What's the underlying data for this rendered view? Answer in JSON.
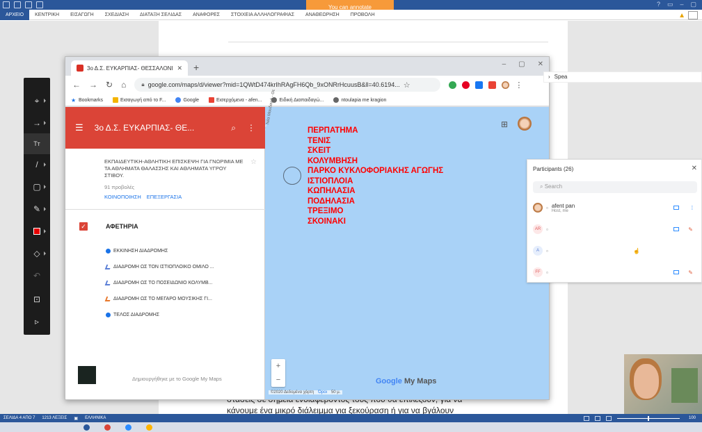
{
  "word": {
    "ribbon_tabs": [
      "ΑΡΧΕΙΟ",
      "ΚΕΝΤΡΙΚΗ",
      "ΕΙΣΑΓΩΓΗ",
      "ΣΧΕΔΙΑΣΗ",
      "ΔΙΑΤΑΞΗ ΣΕΛΙΔΑΣ",
      "ΑΝΑΦΟΡΕΣ",
      "ΣΤΟΙΧΕΙΑ ΑΛΛΗΛΟΓΡΑΦΙΑΣ",
      "ΑΝΑΘΕΩΡΗΣΗ",
      "ΠΡΟΒΟΛΗ"
    ],
    "annotate_banner": "You can annotate",
    "doc_lines": [
      "στάσεις σε σημεία ενδιαφέροντος τους που θα επιλέξουν, για να",
      "κάνουμε ένα μικρό διάλειμμα για ξεκούραση ή για να βγάλουν"
    ],
    "status": [
      "ΣΕΛΙΔΑ 4 ΑΠΟ 7",
      "1213 ΛΕΞΕΙΣ",
      "ΕΛΛΗΝΙΚΑ"
    ],
    "zoom": "100"
  },
  "chrome": {
    "tab_title": "3ο Δ.Σ. ΕΥΚΑΡΠΙΑΣ- ΘΕΣΣΑΛΟΝΙ",
    "url": "google.com/maps/d/viewer?mid=1QWtD474krIhRAgFH6Qb_9xONRrHcuusB&ll=40.6194...",
    "bookmarks": [
      "Bookmarks",
      "Εισαγωγή από το F...",
      "Google",
      "Εισερχόμενα - afen...",
      "Ειδική Διαπαιδαγώ...",
      "ntoulapia me kragion"
    ]
  },
  "map": {
    "title": "3ο Δ.Σ. ΕΥΚΑΡΠΙΑΣ- ΘΕ...",
    "description": "ΕΚΠΑΙΔΕΥΤΙΚΗ-ΑΘΛΗΤΙΚΗ ΕΠΙΣΚΕΨΗ ΓΙΑ ΓΝΩΡΙΜΙΑ ΜΕ ΤΑ ΑΘΛΗΜΑΤΑ ΘΑΛΑΣΣΗΣ ΚΑΙ ΑΘΛΗΜΑΤΑ ΥΓΡΟΥ ΣΤΙΒΟΥ.",
    "views": "91 προβολές",
    "share": "ΚΟΙΝΟΠΟΙΗΣΗ",
    "edit": "ΕΠΕΞΕΡΓΑΣΙΑ",
    "layer": "ΑΦΕΤΗΡΙΑ",
    "items": [
      {
        "label": "ΕΚΚΙΝΗΣΗ ΔΙΑΔΡΟΜΗΣ",
        "kind": "pin",
        "color": "#1a73e8"
      },
      {
        "label": "ΔΙΑΔΡΟΜΗ ΩΣ ΤΟΝ ΙΣΤΙΟΠΛΟΙΚΟ ΟΜΙΛΟ ...",
        "kind": "route",
        "color": "#5b7fd6"
      },
      {
        "label": "ΔΙΑΔΡΟΜΗ ΩΣ ΤΟ ΠΟΣΕΙΔΩΝΙΟ ΚΟΛΥΜΒ...",
        "kind": "route",
        "color": "#5b7fd6"
      },
      {
        "label": "ΔΙΑΔΡΟΜΗ ΩΣ ΤΟ ΜΕΓΑΡΟ ΜΟΥΣΙΚΗΣ ΓΙ...",
        "kind": "route",
        "color": "#e8782b"
      },
      {
        "label": "ΤΕΛΟΣ ΔΙΑΔΡΟΜΗΣ",
        "kind": "pin",
        "color": "#1a73e8"
      }
    ],
    "made_with": "Δημιουργήθηκε με το Google My Maps",
    "road_label": "Νέα Μουδανιά - Θε",
    "annotation_lines": [
      "ΠΕΡΠΑΤΗΜΑ",
      "ΤΕΝΙΣ",
      "ΣΚΕΙΤ",
      "ΚΟΛΥΜΒΗΣΗ",
      "ΠΑΡΚΟ ΚΥΚΛΟΦΟΡΙΑΚΗΣ ΑΓΩΓΗΣ",
      "ΙΣΤΙΟΠΛΟΙΑ",
      "ΚΩΠΗΛΑΣΙΑ",
      "ΠΟΔΗΛΑΣΙΑ",
      "ΤΡΕΞΙΜΟ",
      "ΣΚΟΙΝΑΚΙ"
    ],
    "copyright": "©2020 Δεδομένα χάρτη",
    "terms": "Όροι",
    "scale": "50 μ.",
    "brand_google": "Google",
    "brand_mymaps": "My Maps",
    "annotation_color": "#ff0000",
    "header_color": "#db4437"
  },
  "side": {
    "input_text": "Spea"
  },
  "participants": {
    "title": "Participants (26)",
    "search_placeholder": "Search",
    "rows": [
      {
        "initials": "",
        "name": "afent pan",
        "sub": "Host, me"
      },
      {
        "initials": "AR",
        "name": "",
        "sub": ""
      },
      {
        "initials": "A",
        "name": "",
        "sub": ""
      },
      {
        "initials": "FF",
        "name": "",
        "sub": ""
      }
    ]
  }
}
